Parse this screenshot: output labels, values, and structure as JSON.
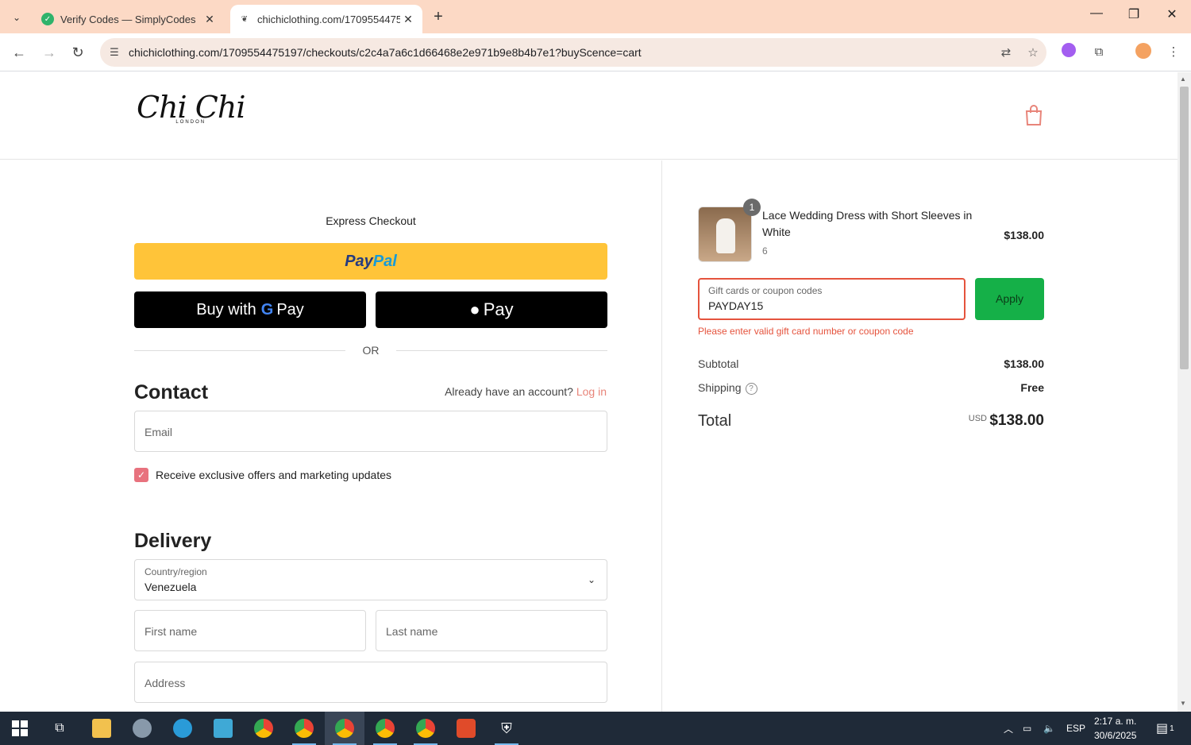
{
  "browser": {
    "tabs": [
      {
        "title": "Verify Codes — SimplyCodes",
        "active": false
      },
      {
        "title": "chichiclothing.com/1709554475",
        "active": true
      }
    ],
    "url": "chichiclothing.com/1709554475197/checkouts/c2c4a7a6c1d66468e2e971b9e8b4b7e1?buyScence=cart"
  },
  "header": {
    "logo_text": "Chi Chi",
    "logo_sub": "LONDON"
  },
  "checkout": {
    "express_title": "Express Checkout",
    "paypal_label_1": "Pay",
    "paypal_label_2": "Pal",
    "gpay_label": "Buy with",
    "gpay_g": "G",
    "gpay_pay": "Pay",
    "apple_pay_label": "Pay",
    "or_label": "OR",
    "contact_title": "Contact",
    "account_prompt": "Already have an account?",
    "login_link": "Log in",
    "email_placeholder": "Email",
    "marketing_label": "Receive exclusive offers and marketing updates",
    "marketing_checked": true,
    "delivery_title": "Delivery",
    "country_label": "Country/region",
    "country_value": "Venezuela",
    "first_name_placeholder": "First name",
    "last_name_placeholder": "Last name",
    "address_placeholder": "Address"
  },
  "summary": {
    "item": {
      "quantity": "1",
      "name": "Lace Wedding Dress with Short Sleeves in White",
      "variant": "6",
      "price": "$138.00"
    },
    "coupon_label": "Gift cards or coupon codes",
    "coupon_value": "PAYDAY15",
    "apply_label": "Apply",
    "coupon_error": "Please enter valid gift card number or coupon code",
    "subtotal_label": "Subtotal",
    "subtotal_value": "$138.00",
    "shipping_label": "Shipping",
    "shipping_value": "Free",
    "total_label": "Total",
    "currency": "USD",
    "total_value": "$138.00"
  },
  "taskbar": {
    "language": "ESP",
    "time": "2:17 a. m.",
    "date": "30/6/2025",
    "notifications": "1"
  },
  "colors": {
    "accent": "#e8857a",
    "error": "#e5533d",
    "apply": "#15b048",
    "paypal": "#ffc439"
  }
}
